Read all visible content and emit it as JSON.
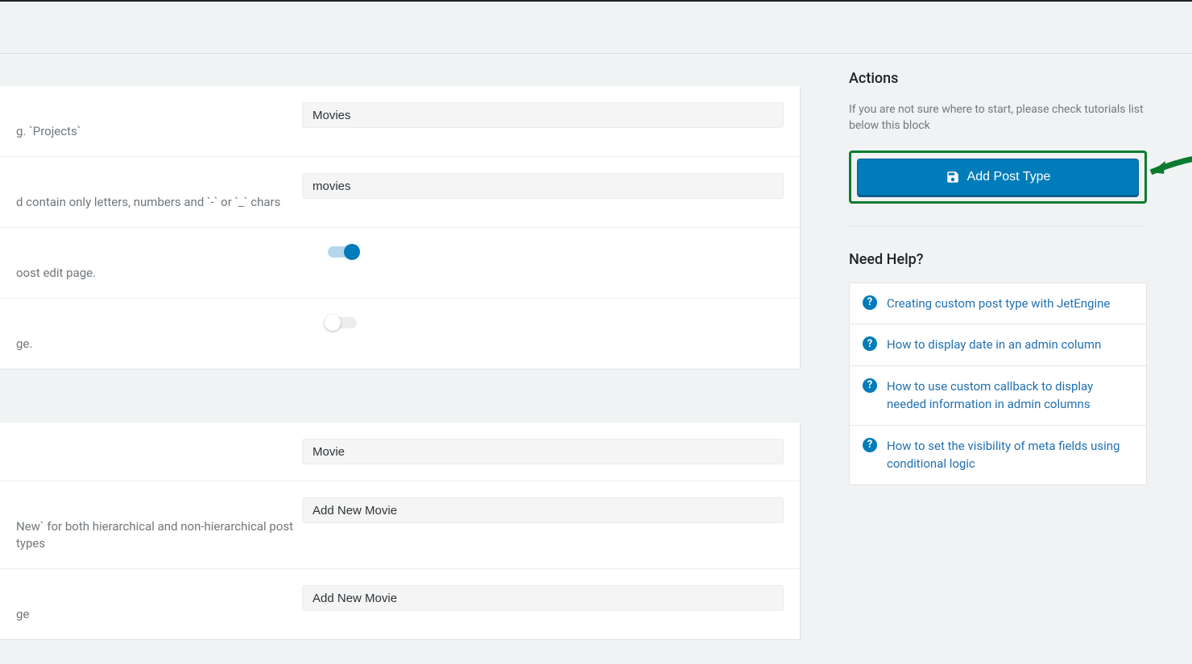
{
  "fields": {
    "name": {
      "desc": "g. `Projects`",
      "value": "Movies"
    },
    "slug": {
      "desc": "d contain only letters, numbers and `-` or `_` chars",
      "value": "movies"
    },
    "toggle1": {
      "desc": "oost edit page.",
      "on": true
    },
    "toggle2": {
      "desc": "ge.",
      "on": false
    },
    "singular": {
      "desc": "",
      "value": "Movie"
    },
    "add_new": {
      "desc": "New` for both hierarchical and non-hierarchical post types",
      "value": "Add New Movie"
    },
    "add_new_item": {
      "desc": "ge",
      "value": "Add New Movie"
    }
  },
  "sidebar": {
    "actions_title": "Actions",
    "actions_desc": "If you are not sure where to start, please check tutorials list below this block",
    "button_label": "Add Post Type",
    "help_title": "Need Help?",
    "help_links": [
      "Creating custom post type with JetEngine",
      "How to display date in an admin column",
      "How to use custom callback to display needed information in admin columns",
      "How to set the visibility of meta fields using conditional logic"
    ]
  }
}
